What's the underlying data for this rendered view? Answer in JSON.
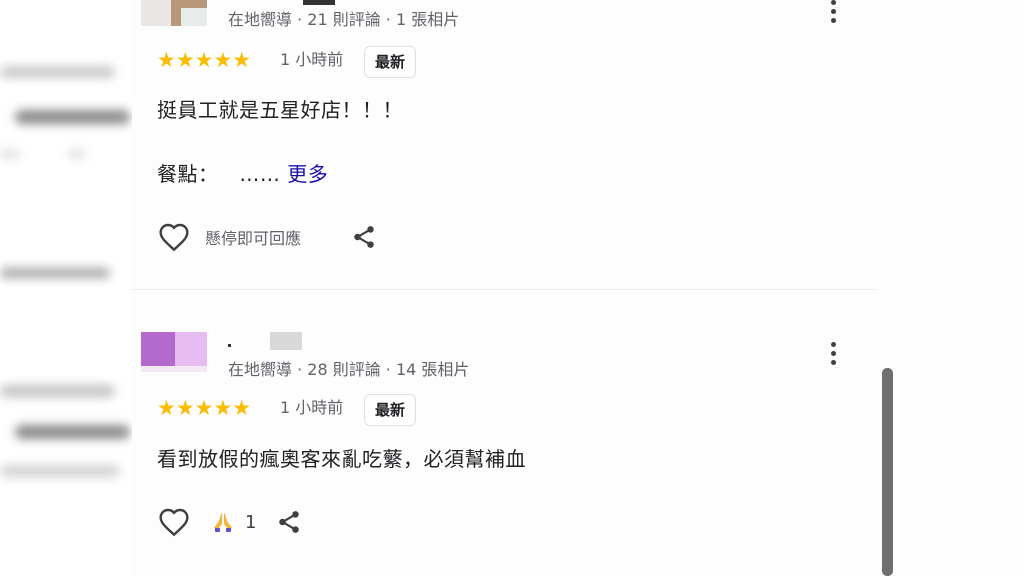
{
  "reviews": [
    {
      "reviewer_meta": "在地嚮導 · 21 則評論 · 1 張相片",
      "rating": 5,
      "stars": "★★★★★",
      "time_ago": "1 小時前",
      "badge": "最新",
      "text": "挺員工就是五星好店！！！",
      "meals_label": "餐點：",
      "meals_value": "……",
      "more_label": "更多",
      "hover_hint": "懸停即可回應",
      "icons": [
        "heart-outline-icon",
        "share-icon",
        "more-vert-icon"
      ]
    },
    {
      "reviewer_meta": "在地嚮導 · 28 則評論 · 14 張相片",
      "rating": 5,
      "stars": "★★★★★",
      "time_ago": "1 小時前",
      "badge": "最新",
      "text": "看到放假的瘋奧客來亂吃蘩，必須幫補血",
      "reaction_emoji": "🙏",
      "reaction_count": "1",
      "icons": [
        "heart-outline-icon",
        "praying-hands-icon",
        "share-icon",
        "more-vert-icon"
      ]
    }
  ],
  "colors": {
    "star": "#fbbc04",
    "link": "#1a0dab",
    "meta_text": "#5f6368",
    "scrollbar": "#6f6f6f"
  }
}
